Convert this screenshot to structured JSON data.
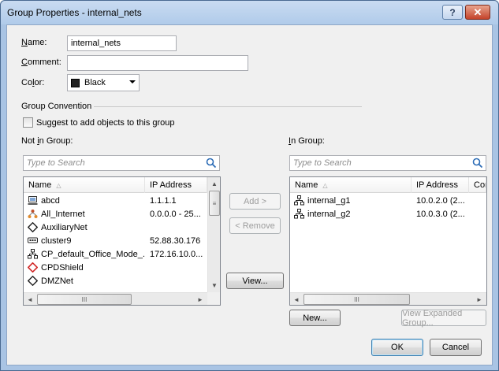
{
  "window": {
    "title": "Group Properties - internal_nets",
    "help_label": "?",
    "close_label": "✕"
  },
  "form": {
    "name_label": "Name:",
    "name_value": "internal_nets",
    "comment_label": "Comment:",
    "comment_value": "",
    "color_label": "Color:",
    "color_value": "Black",
    "color_hex": "#222222"
  },
  "convention": {
    "section_label": "Group Convention",
    "suggest_label": "Suggest to add objects to this group",
    "suggest_checked": false
  },
  "not_in_group": {
    "label": "Not in Group:",
    "search_placeholder": "Type to Search",
    "columns": [
      "Name",
      "IP Address"
    ],
    "rows": [
      {
        "name": "abcd",
        "ip": "1.1.1.1",
        "icon": "host-icon"
      },
      {
        "name": "All_Internet",
        "ip": "0.0.0.0 - 25...",
        "icon": "network-range-icon"
      },
      {
        "name": "AuxiliaryNet",
        "ip": "",
        "icon": "dynamic-object-icon"
      },
      {
        "name": "cluster9",
        "ip": "52.88.30.176",
        "icon": "cluster-icon"
      },
      {
        "name": "CP_default_Office_Mode_...",
        "ip": "172.16.10.0...",
        "icon": "network-icon"
      },
      {
        "name": "CPDShield",
        "ip": "",
        "icon": "dynamic-object-red-icon"
      },
      {
        "name": "DMZNet",
        "ip": "",
        "icon": "dynamic-object-icon"
      }
    ]
  },
  "in_group": {
    "label": "In Group:",
    "search_placeholder": "Type to Search",
    "columns": [
      "Name",
      "IP Address",
      "Cor"
    ],
    "rows": [
      {
        "name": "internal_g1",
        "ip": "10.0.2.0 (2...",
        "icon": "network-icon"
      },
      {
        "name": "internal_g2",
        "ip": "10.0.3.0 (2...",
        "icon": "network-icon"
      }
    ]
  },
  "buttons": {
    "add": "Add  >",
    "remove": "< Remove",
    "view": "View...",
    "new": "New...",
    "view_expanded": "View Expanded Group...",
    "ok": "OK",
    "cancel": "Cancel"
  },
  "scroll_arrows": {
    "up": "▲",
    "down": "▼",
    "left": "◄",
    "right": "►",
    "grip_v": "≡",
    "grip_h": "III"
  }
}
